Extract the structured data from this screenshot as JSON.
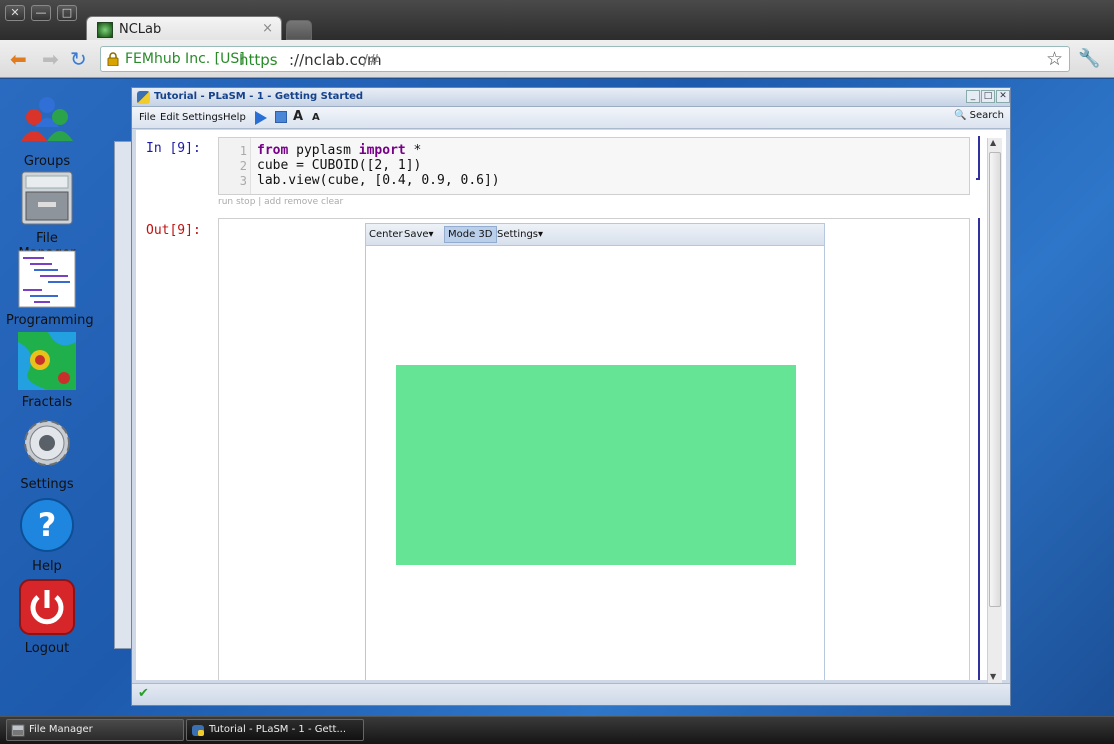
{
  "browser": {
    "tab_title": "NCLab",
    "ev_label": "FEMhub Inc. [US]",
    "url_scheme": "https",
    "url_host": "://nclab.com",
    "url_path": "/#",
    "close_glyph": "×",
    "window_buttons": [
      "✕",
      "—",
      "□"
    ]
  },
  "desktop": {
    "icons": [
      {
        "label": "Groups",
        "icon": "groups-icon"
      },
      {
        "label": "File Manager",
        "icon": "file-manager-icon"
      },
      {
        "label": "Programming",
        "icon": "programming-icon"
      },
      {
        "label": "Fractals",
        "icon": "fractals-icon"
      },
      {
        "label": "Settings",
        "icon": "settings-icon"
      },
      {
        "label": "Help",
        "icon": "help-icon"
      },
      {
        "label": "Logout",
        "icon": "logout-icon"
      }
    ]
  },
  "window": {
    "title": "Tutorial - PLaSM - 1 - Getting Started",
    "menu": [
      "File",
      "Edit",
      "Settings",
      "Help"
    ],
    "search_label": "Search",
    "font_up": "A",
    "font_down": "A"
  },
  "notebook": {
    "in_prompt": "In [9]:",
    "out_prompt": "Out[9]:",
    "line_numbers": [
      "1",
      "2",
      "3"
    ],
    "code": {
      "line1_kw1": "from",
      "line1_mid": " pyplasm ",
      "line1_kw2": "import",
      "line1_rest": " *",
      "line2": "cube = CUBOID([2, 1])",
      "line3": "lab.view(cube, [0.4, 0.9, 0.6])"
    },
    "cell_actions": "run stop | add remove clear",
    "viewer": {
      "center_label": "Center",
      "save_label": "Save▾",
      "mode_label": "Mode 3D",
      "settings_label": "Settings▾",
      "cube_color": "#66e496"
    }
  },
  "taskbar": {
    "items": [
      "File Manager",
      "Tutorial - PLaSM - 1 - Gett..."
    ]
  }
}
